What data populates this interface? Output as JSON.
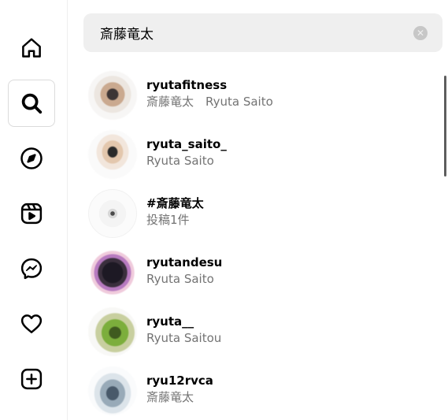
{
  "sidebar": {
    "items": [
      {
        "name": "home",
        "icon": "home-icon"
      },
      {
        "name": "search",
        "icon": "search-icon",
        "active": true
      },
      {
        "name": "explore",
        "icon": "compass-icon"
      },
      {
        "name": "reels",
        "icon": "reels-icon"
      },
      {
        "name": "messages",
        "icon": "messenger-icon"
      },
      {
        "name": "notifications",
        "icon": "heart-icon"
      },
      {
        "name": "create",
        "icon": "plus-square-icon"
      }
    ]
  },
  "search": {
    "value": "斎藤竜太",
    "clear_label": "✕"
  },
  "results": [
    {
      "name": "ryutafitness",
      "subtitle": "斎藤竜太　Ryuta Saito",
      "avatar": "profile-photo"
    },
    {
      "name": "ryuta_saito_",
      "subtitle": "Ryuta Saito",
      "avatar": "profile-photo"
    },
    {
      "name": "#斎藤竜太",
      "subtitle": "投稿1件",
      "avatar": "hashtag-thumbnail"
    },
    {
      "name": "ryutandesu",
      "subtitle": "Ryuta Saito",
      "avatar": "profile-photo-story-ring"
    },
    {
      "name": "ryuta__",
      "subtitle": "Ryuta Saitou",
      "avatar": "profile-photo"
    },
    {
      "name": "ryu12rvca",
      "subtitle": "斎藤竜太",
      "avatar": "profile-photo"
    }
  ],
  "colors": {
    "search_bg": "#efefef",
    "subtitle": "#737373",
    "divider": "#efefef",
    "active_border": "#dbdbdb"
  }
}
